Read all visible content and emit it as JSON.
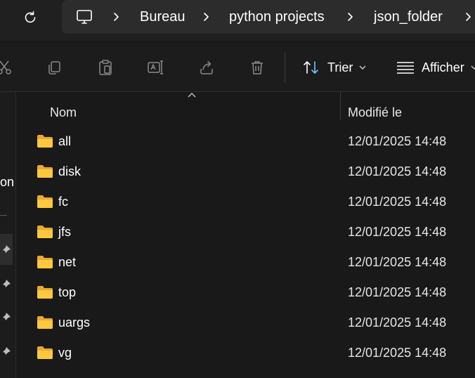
{
  "breadcrumb": {
    "items": [
      "Bureau",
      "python projects",
      "json_folder"
    ]
  },
  "toolbar": {
    "sort_label": "Trier",
    "view_label": "Afficher"
  },
  "nav": {
    "partial_label": "on"
  },
  "list": {
    "columns": {
      "name": "Nom",
      "modified": "Modifié le"
    },
    "rows": [
      {
        "name": "all",
        "modified": "12/01/2025 14:48"
      },
      {
        "name": "disk",
        "modified": "12/01/2025 14:48"
      },
      {
        "name": "fc",
        "modified": "12/01/2025 14:48"
      },
      {
        "name": "jfs",
        "modified": "12/01/2025 14:48"
      },
      {
        "name": "net",
        "modified": "12/01/2025 14:48"
      },
      {
        "name": "top",
        "modified": "12/01/2025 14:48"
      },
      {
        "name": "uargs",
        "modified": "12/01/2025 14:48"
      },
      {
        "name": "vg",
        "modified": "12/01/2025 14:48"
      }
    ]
  },
  "icons": {
    "refresh": "refresh-icon",
    "computer": "computer-icon",
    "chevron": "chevron-right-icon",
    "cut": "cut-icon",
    "copy": "copy-icon",
    "paste": "paste-icon",
    "rename": "rename-icon",
    "share": "share-icon",
    "delete": "delete-icon",
    "sort": "sort-icon",
    "view": "view-lines-icon",
    "folder": "folder-icon",
    "pin": "pin-icon"
  },
  "colors": {
    "accent": "#60cdff",
    "folder": "#ffc83d",
    "background": "#191919"
  }
}
